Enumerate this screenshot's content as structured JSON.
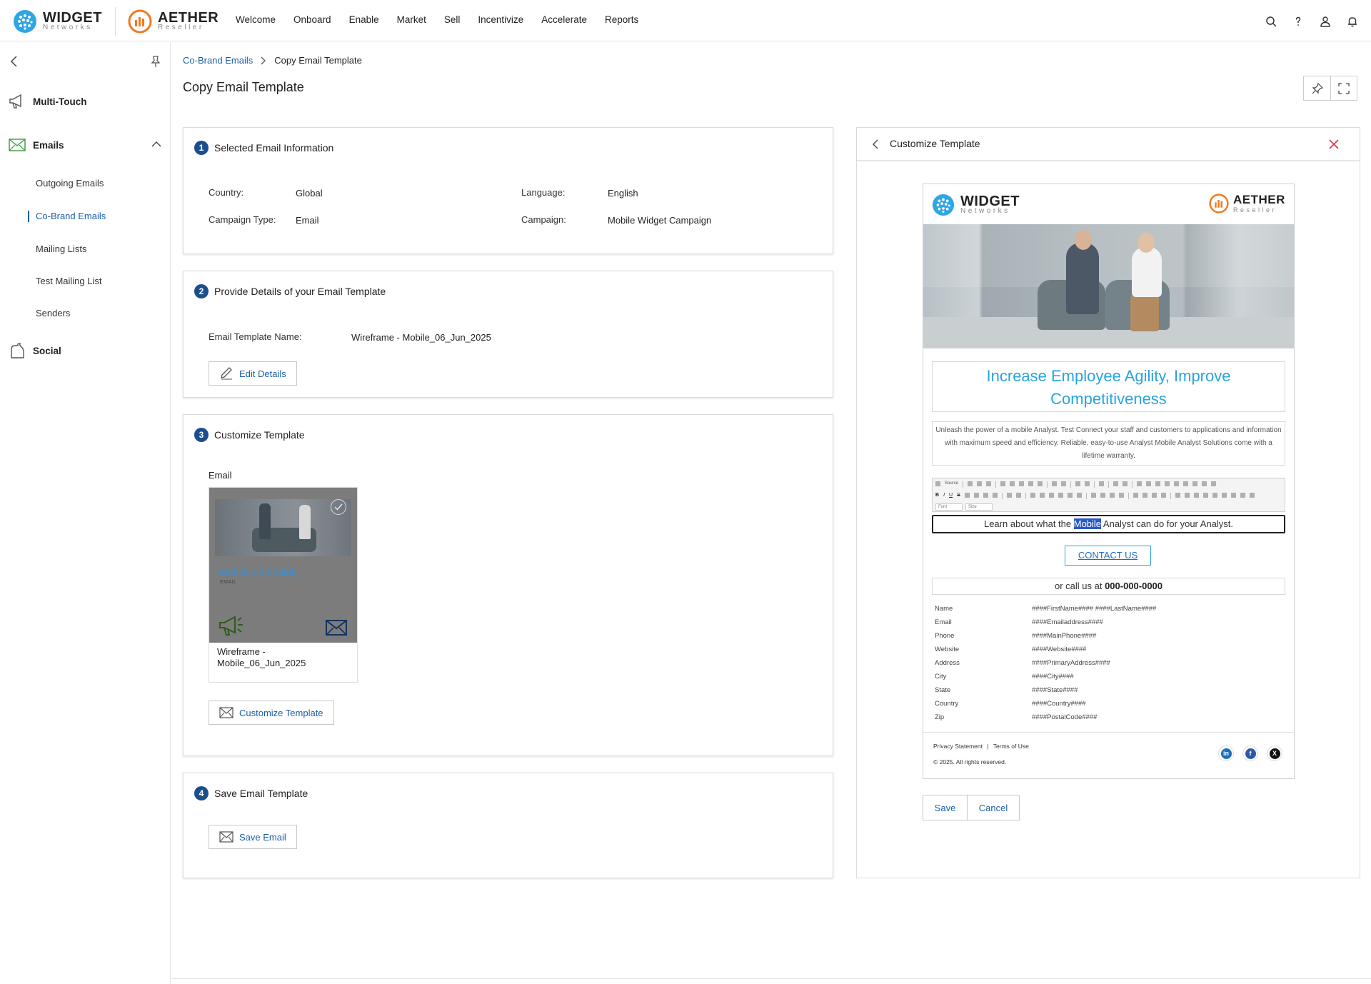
{
  "brand": {
    "widget_name": "WIDGET",
    "widget_sub": "Networks",
    "aether_name": "AETHER",
    "aether_sub": "Reseller",
    "accent": "#1a5fa8",
    "step_color": "#1a4f8e"
  },
  "nav": [
    "Welcome",
    "Onboard",
    "Enable",
    "Market",
    "Sell",
    "Incentivize",
    "Accelerate",
    "Reports"
  ],
  "sidebar": {
    "sections": [
      {
        "label": "Multi-Touch",
        "icon": "megaphone-icon"
      },
      {
        "label": "Emails",
        "icon": "envelope-icon"
      },
      {
        "label": "Social",
        "icon": "social-icon"
      }
    ],
    "email_items": [
      "Outgoing Emails",
      "Co-Brand Emails",
      "Mailing Lists",
      "Test Mailing List",
      "Senders"
    ]
  },
  "breadcrumb": {
    "parent": "Co-Brand Emails",
    "current": "Copy Email Template"
  },
  "page_title": "Copy Email Template",
  "step1": {
    "number": "1",
    "title": "Selected Email Information",
    "country_label": "Country:",
    "country": "Global",
    "language_label": "Language:",
    "language": "English",
    "campaign_type_label": "Campaign Type:",
    "campaign_type": "Email",
    "campaign_label": "Campaign:",
    "campaign": "Mobile Widget Campaign"
  },
  "step2": {
    "number": "2",
    "title": "Provide Details of your Email Template",
    "name_label": "Email Template Name:",
    "name_value": "Wireframe - Mobile_06_Jun_2025",
    "edit_button": "Edit Details"
  },
  "step3": {
    "number": "3",
    "title": "Customize Template",
    "section_label": "Email",
    "card_title": "Mobile Campaign",
    "card_sub": "EMAIL",
    "card_name": "Wireframe - Mobile_06_Jun_2025",
    "customize_button": "Customize Template"
  },
  "step4": {
    "number": "4",
    "title": "Save Email Template",
    "save_button": "Save Email"
  },
  "panel": {
    "title": "Customize Template",
    "email": {
      "headline": "Increase Employee Agility, Improve Competitiveness",
      "body": "Unleash the power of a mobile Analyst. Test Connect your staff and customers to applications and information with maximum speed and efficiency. Reliable, easy-to-use Analyst Mobile Analyst Solutions come with a lifetime warranty.",
      "editor_font": "Font",
      "editor_size": "Size",
      "toolbar_source": "Source",
      "edit_before": "Learn about what the ",
      "edit_highlight": "Mobile",
      "edit_after": " Analyst can do for your Analyst.",
      "cta": "CONTACT US",
      "call_prefix": "or call us at ",
      "call_number": "000-000-0000",
      "fields": [
        {
          "label": "Name",
          "value": "####FirstName#### ####LastName####"
        },
        {
          "label": "Email",
          "value": "####Emailaddress####"
        },
        {
          "label": "Phone",
          "value": "####MainPhone####"
        },
        {
          "label": "Website",
          "value": "####Website####"
        },
        {
          "label": "Address",
          "value": "####PrimaryAddress####"
        },
        {
          "label": "City",
          "value": "####City####"
        },
        {
          "label": "State",
          "value": "####State####"
        },
        {
          "label": "Country",
          "value": "####Country####"
        },
        {
          "label": "Zip",
          "value": "####PostalCode####"
        }
      ],
      "privacy": "Privacy Statement",
      "terms": "Terms of Use",
      "copyright": "© 2025. All rights reserved.",
      "headline_color": "#27a4e0"
    },
    "save": "Save",
    "cancel": "Cancel"
  }
}
